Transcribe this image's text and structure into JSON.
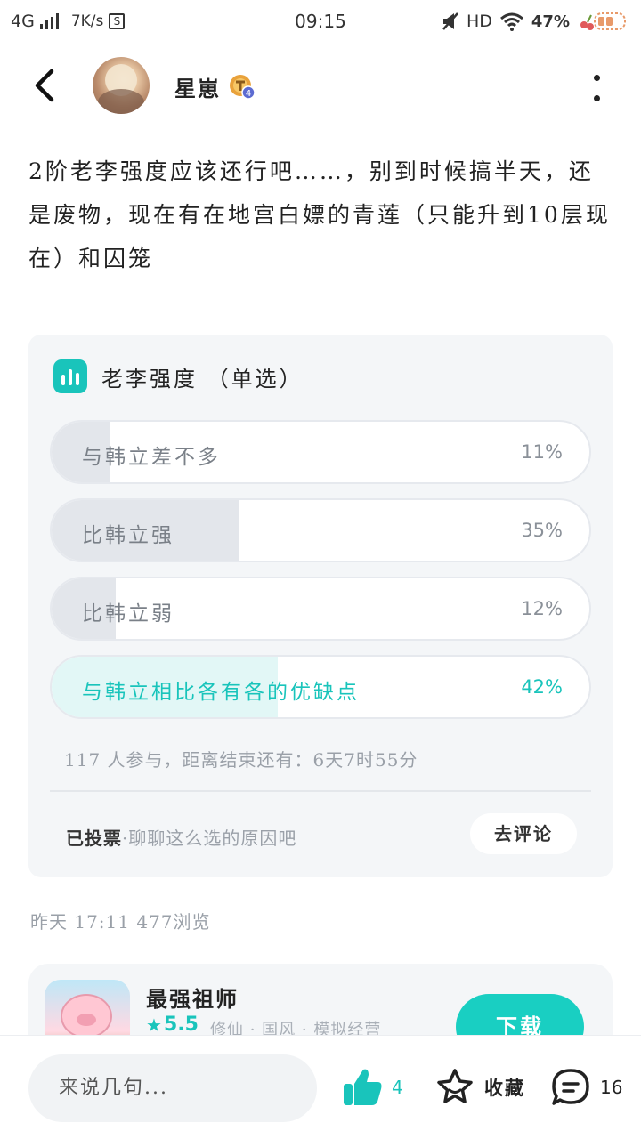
{
  "status_bar": {
    "network": "4G",
    "speed": "7K/s",
    "speed_icon_letter": "S",
    "time": "09:15",
    "hd": "HD",
    "battery": "47%",
    "icons": [
      "signal-icon",
      "speed-icon",
      "mute-icon",
      "wifi-icon",
      "battery-icon"
    ]
  },
  "header": {
    "username": "星崽",
    "level_badge": "4",
    "icons": [
      "back-arrow-icon",
      "avatar",
      "level-badge-icon",
      "more-icon"
    ]
  },
  "post": {
    "text": "2阶老李强度应该还行吧……，别到时候搞半天，还是废物，现在有在地宫白嫖的青莲（只能升到10层现在）和囚笼",
    "meta": "昨天 17:11  477浏览"
  },
  "poll": {
    "title": "老李强度 （单选）",
    "options": [
      {
        "label": "与韩立差不多",
        "percent": "11%",
        "fraction": 0.11,
        "selected": false
      },
      {
        "label": "比韩立强",
        "percent": "35%",
        "fraction": 0.35,
        "selected": false
      },
      {
        "label": "比韩立弱",
        "percent": "12%",
        "fraction": 0.12,
        "selected": false
      },
      {
        "label": "与韩立相比各有各的优缺点",
        "percent": "42%",
        "fraction": 0.42,
        "selected": true
      }
    ],
    "info": "117 人参与，距离结束还有：6天7时55分",
    "voted_label": "已投票",
    "voted_sub": "·聊聊这么选的原因吧",
    "comment_button": "去评论"
  },
  "game": {
    "name": "最强祖师",
    "rating": "5.5",
    "tags": "修仙 · 国风 · 模拟经营",
    "download_button": "下载"
  },
  "bottom_bar": {
    "input_placeholder": "来说几句...",
    "like_count": "4",
    "favorite_label": "收藏",
    "reply_count": "16"
  },
  "colors": {
    "accent": "#19c4bb",
    "poll_bg": "#f4f6f8",
    "bar_fill": "#e3e6eb",
    "selected_fill": "#e2f7f6"
  }
}
